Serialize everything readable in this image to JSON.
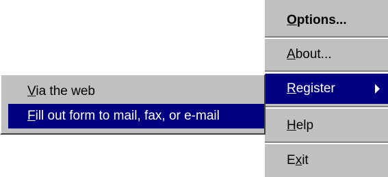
{
  "colors": {
    "menu_bg": "#c0c0c0",
    "highlight_bg": "#000080",
    "highlight_text": "#ffffff",
    "text": "#000000"
  },
  "main_menu": {
    "items": [
      {
        "mnemonic": "O",
        "rest": "ptions...",
        "default": true
      },
      {
        "mnemonic": "A",
        "rest": "bout..."
      },
      {
        "mnemonic": "R",
        "rest": "egister",
        "selected": true,
        "has_submenu": true
      },
      {
        "mnemonic": "H",
        "rest": "elp"
      },
      {
        "pre": "E",
        "mnemonic": "x",
        "rest": "it"
      }
    ]
  },
  "submenu": {
    "items": [
      {
        "mnemonic": "V",
        "rest": "ia the web"
      },
      {
        "mnemonic": "F",
        "rest": "ill out form to mail, fax, or e-mail",
        "selected": true
      }
    ]
  },
  "icons": {
    "submenu_arrow": "triangle-right-icon"
  }
}
